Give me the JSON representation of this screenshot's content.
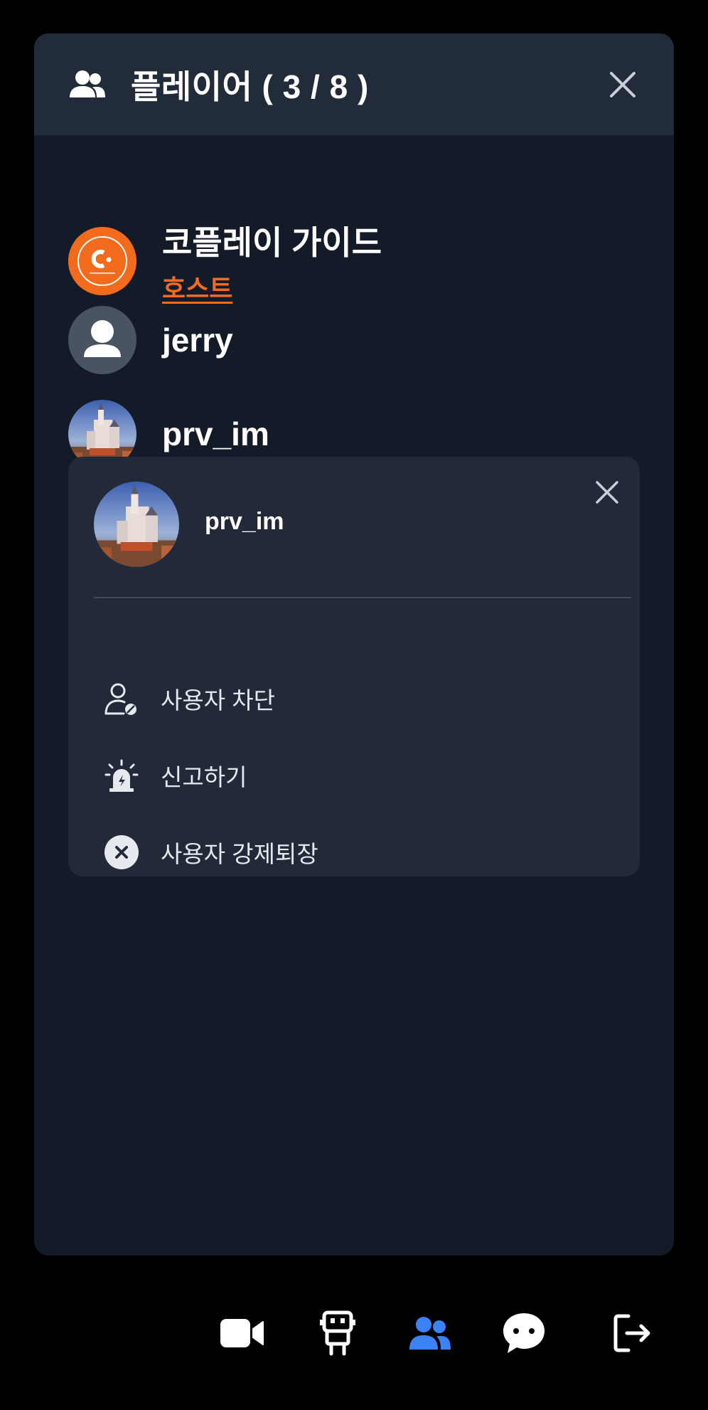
{
  "panel": {
    "title": "플레이어 ( 3 / 8 )",
    "header_icon": "users-icon",
    "close_icon": "close-icon"
  },
  "players": [
    {
      "name": "코플레이 가이드",
      "role": "호스트",
      "avatar": "coplay-logo-avatar"
    },
    {
      "name": "jerry",
      "avatar": "default-user-avatar"
    },
    {
      "name": "prv_im",
      "avatar": "castle-photo-avatar"
    }
  ],
  "popup": {
    "username": "prv_im",
    "close_icon": "close-icon",
    "menu": [
      {
        "label": "사용자 차단",
        "icon": "user-block-icon"
      },
      {
        "label": "신고하기",
        "icon": "siren-icon"
      },
      {
        "label": "사용자 강제퇴장",
        "icon": "x-circle-icon"
      }
    ]
  },
  "bottom_bar": {
    "items": [
      {
        "icon": "video-camera-icon",
        "active": false
      },
      {
        "icon": "robot-icon",
        "active": false
      },
      {
        "icon": "users-icon",
        "active": true
      },
      {
        "icon": "chat-bubble-icon",
        "active": false
      },
      {
        "icon": "exit-icon",
        "active": false
      }
    ],
    "active_color": "#3b82f6",
    "inactive_color": "#ffffff"
  },
  "colors": {
    "panel_bg": "#131a28",
    "header_bg": "#222b3a",
    "host_accent": "#f26a1b"
  }
}
